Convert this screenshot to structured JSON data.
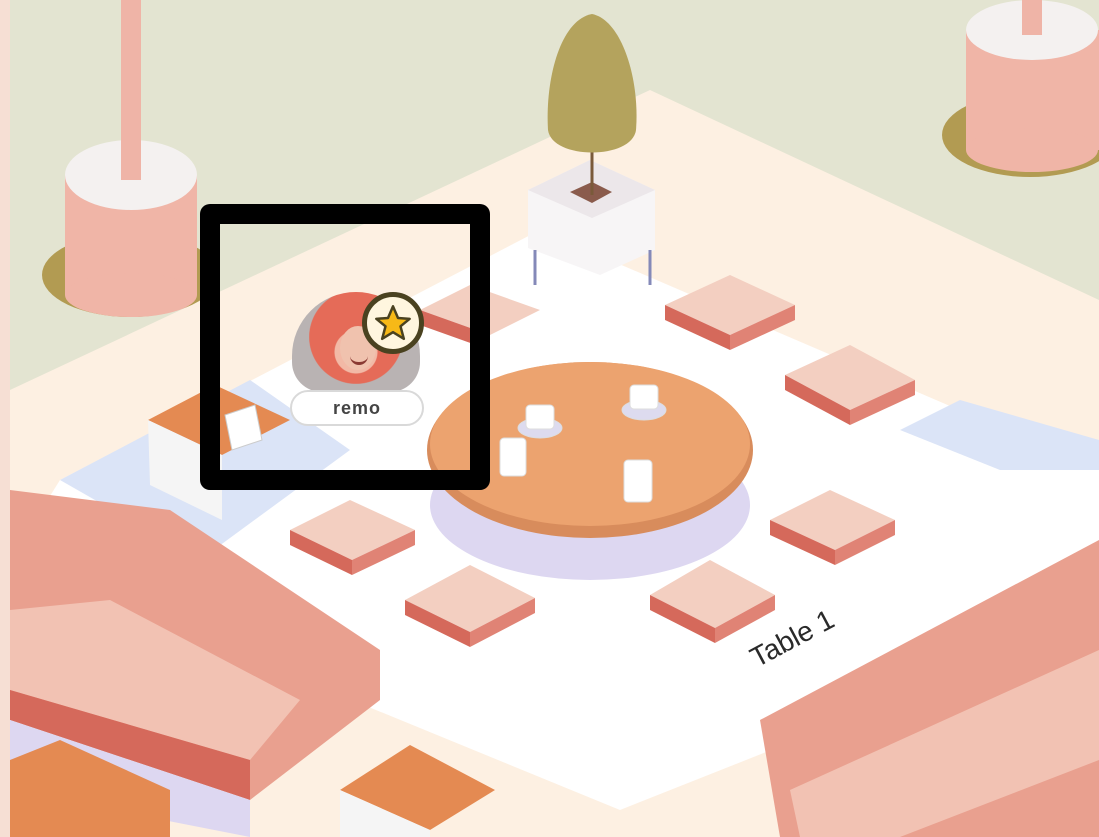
{
  "scene": {
    "table_label": "Table 1"
  },
  "avatar": {
    "badge_text": "remo",
    "icon": "star-icon",
    "colors": {
      "frame": "#000000",
      "star": "#f7b917",
      "brand_dot": "#e8554a"
    }
  },
  "colors": {
    "floor_outer": "#f6dfd4",
    "floor_inner": "#fdf0e2",
    "carpet": "#ffffff",
    "green_area": "#e3e4d1",
    "table_top": "#eca36f",
    "stool_top": "#f3cfc1",
    "sofa": "#e9a08f"
  }
}
